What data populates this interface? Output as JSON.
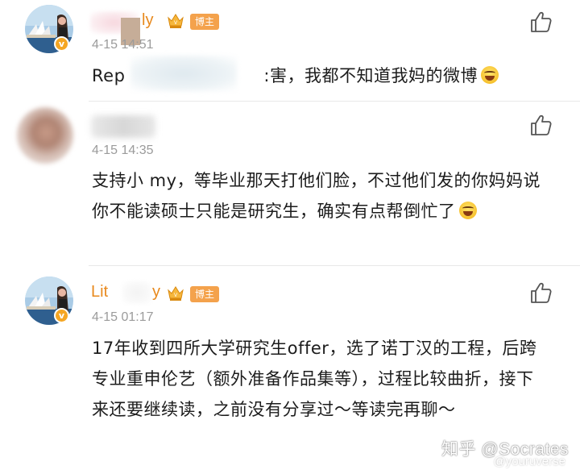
{
  "comments": [
    {
      "name_visible": "ly",
      "badge": "博主",
      "time": "4-15 14:51",
      "text_prefix": "Rep",
      "text": ":害，我都不知道我妈的微博",
      "like_icon": "thumbs-up-icon",
      "avatar_icon": "opera-house-avatar"
    },
    {
      "name_visible": "",
      "time": "4-15 14:35",
      "text": "支持小 my，等毕业那天打他们脸，不过他们发的你妈妈说你不能读硕士只能是研究生，确实有点帮倒忙了",
      "like_icon": "thumbs-up-icon",
      "avatar_icon": "blurred-avatar"
    },
    {
      "name_visible": "Lit",
      "name_tail": "y",
      "badge": "博主",
      "time": "4-15 01:17",
      "text": "17年收到四所大学研究生offer，选了诺丁汉的工程，后跨专业重申伦艺（额外准备作品集等），过程比较曲折，接下来还要继续读，之前没有分享过～等读完再聊～",
      "like_icon": "thumbs-up-icon",
      "avatar_icon": "opera-house-avatar"
    }
  ],
  "watermark": {
    "zhihu": "知乎 @Socrates",
    "weibo": "@youruverse"
  },
  "colors": {
    "name": "#e8891d",
    "badge": "#f4a24c",
    "time": "#9b9b9b",
    "divider": "#e8e8e8"
  }
}
